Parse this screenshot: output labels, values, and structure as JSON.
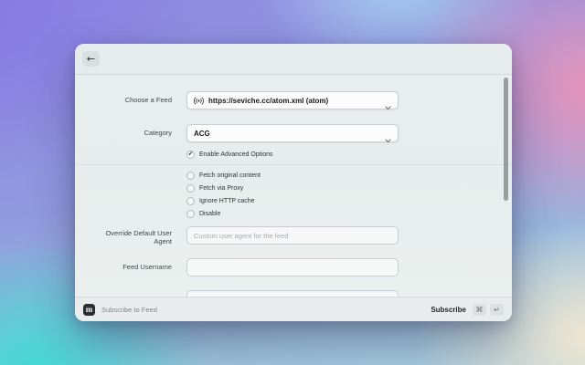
{
  "header": {
    "back_icon": "←"
  },
  "form": {
    "feed": {
      "label": "Choose a Feed",
      "value": "https://seviche.cc/atom.xml (atom)"
    },
    "category": {
      "label": "Category",
      "value": "ACG"
    },
    "enable_advanced": {
      "label": "Enable Advanced Options",
      "checked": true,
      "check_glyph": "✓"
    },
    "advanced_options": [
      {
        "label": "Fetch original content",
        "checked": false
      },
      {
        "label": "Fetch via Proxy",
        "checked": false
      },
      {
        "label": "Ignore HTTP cache",
        "checked": false
      },
      {
        "label": "Disable",
        "checked": false
      }
    ],
    "user_agent": {
      "label": "Override Default User Agent",
      "placeholder": "Custom user agent for the feed",
      "value": ""
    },
    "username": {
      "label": "Feed Username",
      "value": ""
    }
  },
  "footer": {
    "app_icon_letter": "m",
    "title": "Subscribe to Feed",
    "subscribe_label": "Subscribe",
    "shortcut_keys": [
      "⌘",
      "↵"
    ]
  },
  "icons": {
    "back": "←",
    "chevron_down": "⌄",
    "feed_signal": "((•))",
    "checkmark": "✓",
    "command_key": "⌘",
    "return_key": "↵"
  },
  "colors": {
    "window_bg": "#e8edee",
    "footer_bg": "#e9eced",
    "logo_bg": "#2c2f30",
    "bg_top_left": "#8878e2",
    "bg_top_right": "#ec93b9",
    "bg_bottom_left": "#3fd9d3",
    "bg_bottom_right": "#f2e6cf",
    "bg_bottom_center": "#9cc8dc"
  }
}
